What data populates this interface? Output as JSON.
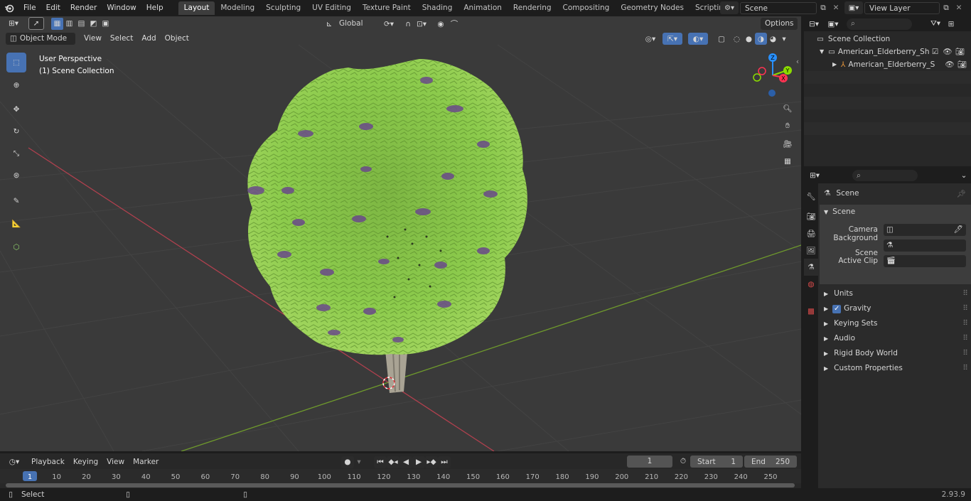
{
  "topbar": {
    "menus": [
      "File",
      "Edit",
      "Render",
      "Window",
      "Help"
    ],
    "workspaces": [
      "Layout",
      "Modeling",
      "Sculpting",
      "UV Editing",
      "Texture Paint",
      "Shading",
      "Animation",
      "Rendering",
      "Compositing",
      "Geometry Nodes",
      "Scripting"
    ],
    "active_workspace": "Layout",
    "scene_name": "Scene",
    "view_layer": "View Layer"
  },
  "viewport": {
    "mode": "Object Mode",
    "menus": [
      "View",
      "Select",
      "Add",
      "Object"
    ],
    "transform_orientation": "Global",
    "options_label": "Options",
    "overlay_title": "User Perspective",
    "overlay_collection": "(1) Scene Collection",
    "gizmo_axes": [
      "Z",
      "Y",
      "X"
    ]
  },
  "outliner": {
    "root": "Scene Collection",
    "items": [
      {
        "label": "American_Elderberry_Shrub_v"
      },
      {
        "label": "American_Elderberry_Shr"
      }
    ]
  },
  "properties": {
    "context_title": "Scene",
    "panel_title": "Scene",
    "fields": [
      {
        "label": "Camera"
      },
      {
        "label": "Background Scene"
      },
      {
        "label": "Active Clip"
      }
    ],
    "sections": [
      {
        "label": "Units",
        "checkbox": false
      },
      {
        "label": "Gravity",
        "checkbox": true
      },
      {
        "label": "Keying Sets",
        "checkbox": false
      },
      {
        "label": "Audio",
        "checkbox": false
      },
      {
        "label": "Rigid Body World",
        "checkbox": false
      },
      {
        "label": "Custom Properties",
        "checkbox": false
      }
    ]
  },
  "timeline": {
    "menus": [
      "Playback",
      "Keying",
      "View",
      "Marker"
    ],
    "current_frame": "1",
    "start_label": "Start",
    "start_value": "1",
    "end_label": "End",
    "end_value": "250",
    "ticks": [
      "1",
      "10",
      "20",
      "30",
      "40",
      "50",
      "60",
      "70",
      "80",
      "90",
      "100",
      "110",
      "120",
      "130",
      "140",
      "150",
      "160",
      "170",
      "180",
      "190",
      "200",
      "210",
      "220",
      "230",
      "240",
      "250"
    ]
  },
  "statusbar": {
    "hint": "Select",
    "version": "2.93.9"
  },
  "colors": {
    "accent": "#4772b3",
    "x_axis": "#ff3352",
    "y_axis": "#8bdc00",
    "z_axis": "#2890ff",
    "foliage": "#8dc44a",
    "flowers": "#6a4a8a"
  }
}
